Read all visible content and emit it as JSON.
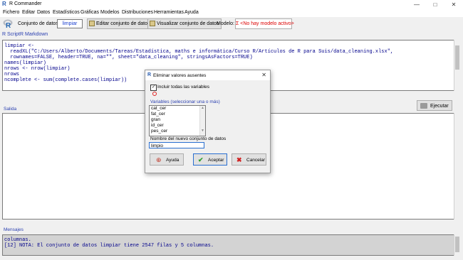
{
  "window": {
    "title": "R Commander",
    "minimize": "—",
    "maximize": "□",
    "close": "✕"
  },
  "menu": [
    "Fichero",
    "Editar",
    "Datos",
    "Estadísticos",
    "Gráficas",
    "Modelos",
    "Distribuciones",
    "Herramientas",
    "Ayuda"
  ],
  "toolbar": {
    "dataset_label": "Conjunto de datos:",
    "dataset_value": "limpiar",
    "edit_button": "Editar conjunto de datos",
    "view_button": "Visualizar conjunto de datos",
    "model_label": "Modelo:",
    "model_value": "Σ <No hay modelo activo>"
  },
  "tabs": {
    "script": "R Script",
    "markdown": "R Markdown"
  },
  "script_lines": [
    "limpiar <- ",
    "  readXL(\"C:/Users/Alberto/Documents/Tareas/Estadística, maths e informática/Curso R/Artículos de R para Suis/data_cleaning.xlsx\",",
    "  rownames=FALSE, header=TRUE, na=\"\", sheet=\"data_cleaning\", stringsAsFactors=TRUE)",
    "",
    "names(limpiar)",
    "nrows <- nrow(limpiar)",
    "nrows",
    "ncomplete <- sum(complete.cases(limpiar))"
  ],
  "output": {
    "label": "Salida",
    "execute_button": "Ejecutar"
  },
  "messages": {
    "label": "Mensajes",
    "lines": [
      "columnas.",
      "[12] NOTA: El conjunto de datos limpiar tiene 2547 filas y 5 columnas."
    ]
  },
  "dialog": {
    "title": "Eliminar valores ausentes",
    "include_all_label": "Incluir todas las variables",
    "include_all_checked": true,
    "variables_label": "Variables (seleccionar una o más)",
    "variables": [
      "cat_cer",
      "fat_cer",
      "gran",
      "id_cer",
      "pes_cer"
    ],
    "new_dataset_label": "Nombre del nuevo conjunto de datos",
    "new_dataset_value": "limpio",
    "help_button": "Ayuda",
    "ok_button": "Aceptar",
    "cancel_button": "Cancelar",
    "help_icon": "lifebuoy-icon",
    "ok_icon": "checkmark-icon",
    "cancel_icon": "x-icon"
  }
}
